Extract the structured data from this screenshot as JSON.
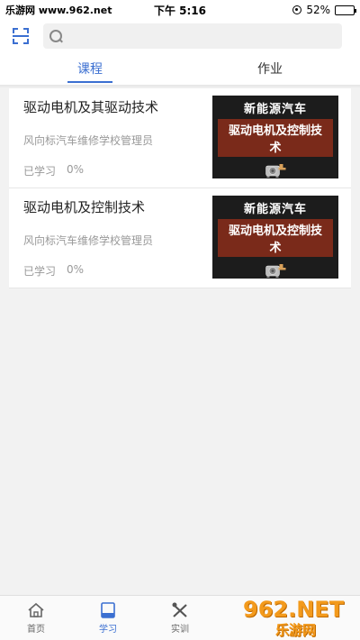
{
  "status_bar": {
    "left": "乐游网 www.962.net",
    "time": "下午 5:16",
    "battery": "52%",
    "battery_level": 0.52
  },
  "search": {
    "placeholder": ""
  },
  "tabs": [
    {
      "label": "课程",
      "active": true
    },
    {
      "label": "作业",
      "active": false
    }
  ],
  "courses": [
    {
      "title": "驱动电机及其驱动技术",
      "author": "风向标汽车维修学校管理员",
      "progress_label": "已学习",
      "progress_value": "0%",
      "thumb_line1": "新能源汽车",
      "thumb_line2": "驱动电机及控制技术"
    },
    {
      "title": "驱动电机及控制技术",
      "author": "风向标汽车维修学校管理员",
      "progress_label": "已学习",
      "progress_value": "0%",
      "thumb_line1": "新能源汽车",
      "thumb_line2": "驱动电机及控制技术"
    }
  ],
  "nav": [
    {
      "label": "首页",
      "icon": "home-icon",
      "active": false
    },
    {
      "label": "学习",
      "icon": "book-icon",
      "active": true
    },
    {
      "label": "实训",
      "icon": "tools-icon",
      "active": false
    }
  ],
  "watermark": {
    "top": "962.NET",
    "bottom": "乐游网"
  },
  "colors": {
    "accent": "#3b6fd1",
    "background": "#f2f2f2"
  }
}
